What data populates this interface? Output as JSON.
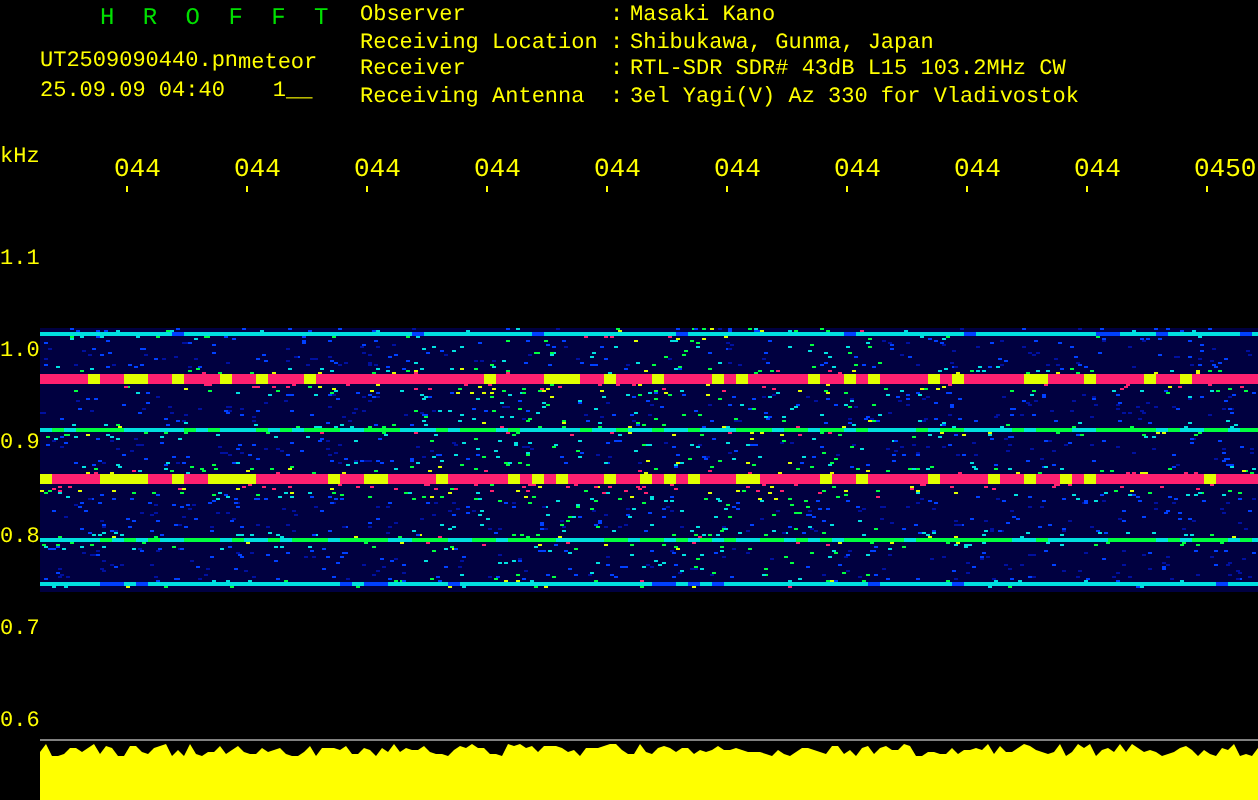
{
  "header": {
    "title": "H R O F F T",
    "file_name": "UT2509090440.pn",
    "label": "meteor",
    "timestamp": "25.09.09 04:40",
    "counter": "1__"
  },
  "info": [
    {
      "label": "Observer",
      "separator": ":",
      "value": "Masaki Kano"
    },
    {
      "label": "Receiving Location",
      "separator": ":",
      "value": "Shibukawa, Gunma, Japan"
    },
    {
      "label": "Receiver",
      "separator": ":",
      "value": "RTL-SDR SDR# 43dB L15 103.2MHz CW"
    },
    {
      "label": "Receiving Antenna",
      "separator": ":",
      "value": "3el Yagi(V) Az 330 for Vladivostok"
    }
  ],
  "time_labels": [
    "044",
    "044",
    "044",
    "044",
    "044",
    "044",
    "044",
    "044",
    "044",
    "0450"
  ],
  "frequency_axis": {
    "unit": "kHz",
    "labels": [
      "1.1",
      "1.0",
      "0.9",
      "0.8",
      "0.7",
      "0.6"
    ]
  }
}
